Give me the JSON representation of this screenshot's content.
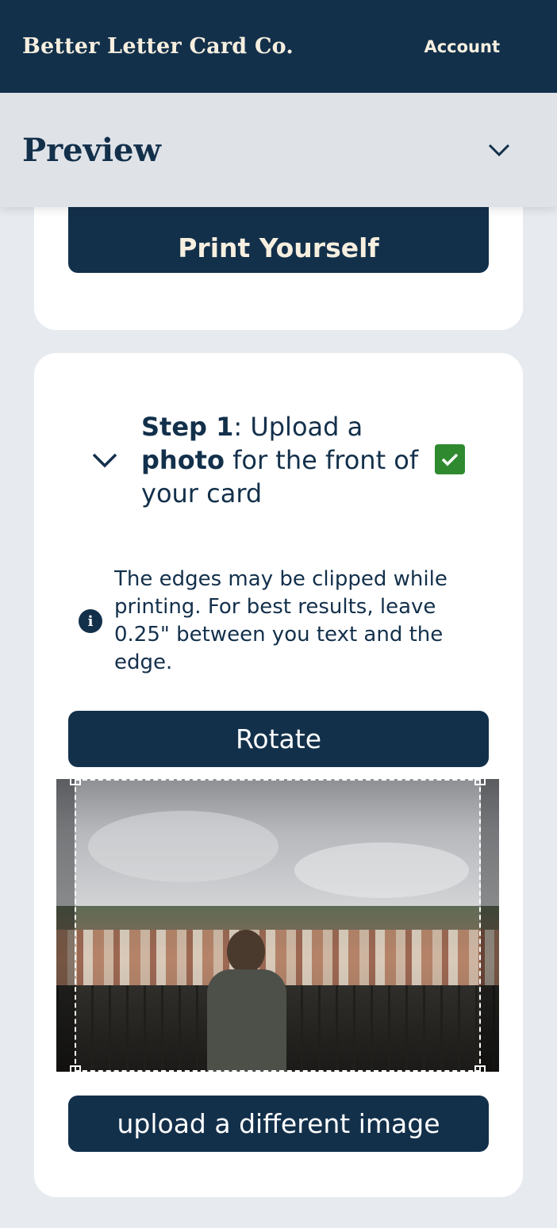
{
  "header": {
    "brand": "Better Letter Card Co.",
    "account_label": "Account",
    "bg_color": "#13304b",
    "text_color": "#f6efdf"
  },
  "preview": {
    "title": "Preview",
    "toggle_icon": "chevron-down-icon"
  },
  "print_card": {
    "button_label": "Print Yourself"
  },
  "step": {
    "number_label": "Step 1",
    "text_1": ": Upload a ",
    "text_bold": "photo",
    "text_2": " for the front of your card",
    "expand_icon": "chevron-down-icon",
    "status_icon": "checkmark-icon",
    "status_color": "#2f8a2f",
    "completed": true
  },
  "info": {
    "icon": "info-icon",
    "text": "The edges may be clipped while printing. For best results, leave 0.25\" between you text and the edge."
  },
  "actions": {
    "rotate_label": "Rotate",
    "upload_label": "upload a different image"
  },
  "photo": {
    "subject": "person-at-viewpoint-over-city",
    "crop_active": true
  },
  "colors": {
    "primary": "#13304b",
    "page_bg": "#e7ebf0",
    "card_bg": "#ffffff",
    "success": "#2f8a2f"
  }
}
